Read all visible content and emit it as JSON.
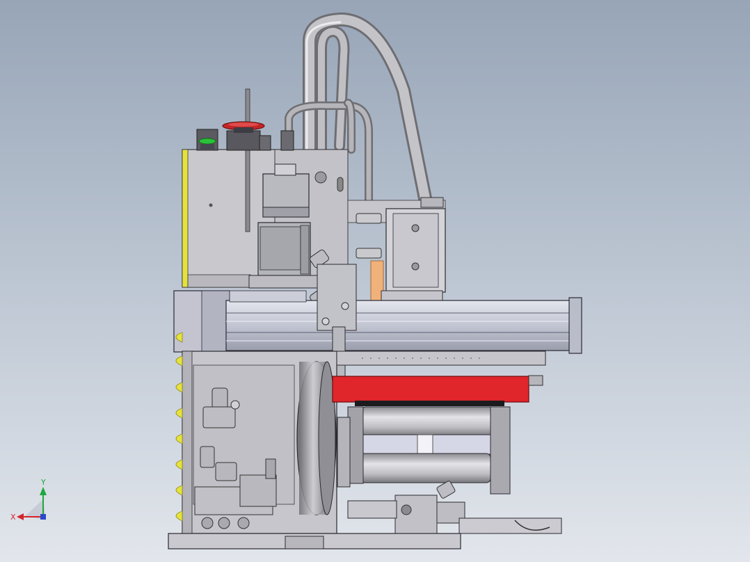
{
  "viewport": {
    "background_top": "#97a5b7",
    "background_bottom": "#e2e6ec"
  },
  "triad": {
    "x_label": "X",
    "y_label": "Y",
    "x_color": "#d8232a",
    "y_color": "#1ea83c"
  },
  "model": {
    "highlight_color": "#e0252b",
    "status_light_green": "#2cc13a",
    "status_light_red": "#d42a2a",
    "side_panel_yellow": "#e8e23a",
    "body_gray": "#c9c9cf",
    "tube_gray": "#a8a8ac"
  }
}
